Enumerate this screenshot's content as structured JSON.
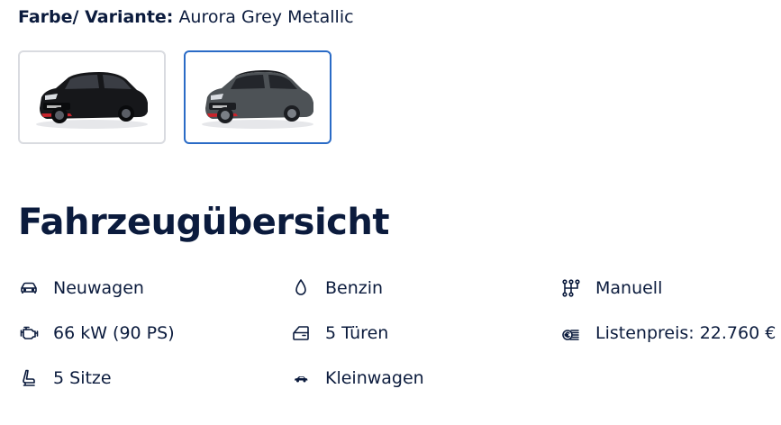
{
  "variant": {
    "label": "Farbe/ Variante:",
    "value": "Aurora Grey Metallic"
  },
  "swatches": [
    {
      "color": "#16171a",
      "accent": "#c8242c",
      "selected": false
    },
    {
      "color": "#4d5256",
      "accent": "#c8242c",
      "selected": true
    }
  ],
  "overview": {
    "title": "Fahrzeugübersicht",
    "specs": [
      {
        "icon": "car-icon",
        "label": "Neuwagen"
      },
      {
        "icon": "fuel-drop-icon",
        "label": "Benzin"
      },
      {
        "icon": "gearshift-icon",
        "label": "Manuell"
      },
      {
        "icon": "engine-icon",
        "label": "66 kW (90 PS)"
      },
      {
        "icon": "door-icon",
        "label": "5 Türen"
      },
      {
        "icon": "price-icon",
        "label": "Listenpreis: 22.760 €"
      },
      {
        "icon": "seat-icon",
        "label": "5 Sitze"
      },
      {
        "icon": "small-car-icon",
        "label": "Kleinwagen"
      }
    ]
  }
}
